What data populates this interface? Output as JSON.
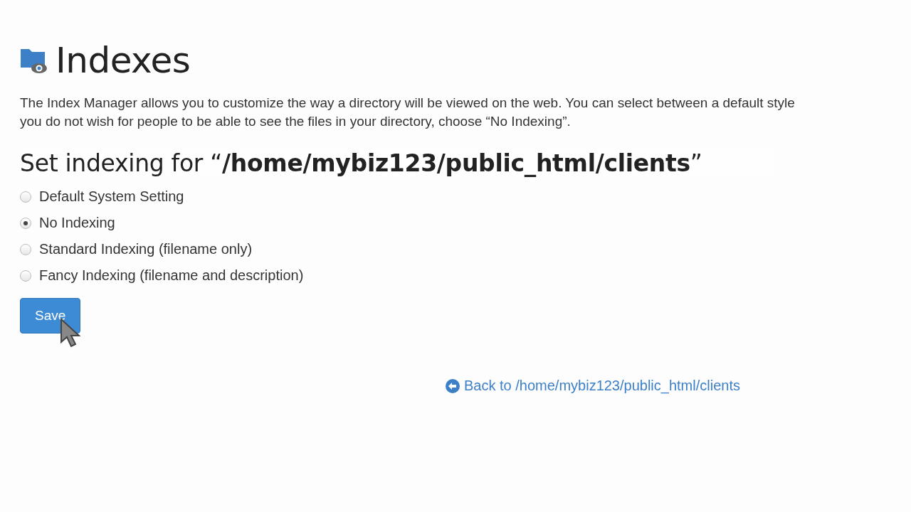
{
  "page": {
    "title": "Indexes",
    "description": [
      "The Index Manager allows you to customize the way a directory will be viewed on the web. You can select between a default style",
      "you do not wish for people to be able to see the files in your directory, choose “No Indexing”."
    ]
  },
  "form": {
    "heading": "Set indexing for “**/home/mybiz123/public_html/clients**”",
    "options": [
      {
        "label": "Default System Setting",
        "selected": false
      },
      {
        "label": "No Indexing",
        "selected": true
      },
      {
        "label": "Standard Indexing (filename only)",
        "selected": false
      },
      {
        "label": "Fancy Indexing (filename and description)",
        "selected": false
      }
    ],
    "save_button": "Save"
  },
  "back_link": "Back to /home/mybiz123/public_html/clients"
}
